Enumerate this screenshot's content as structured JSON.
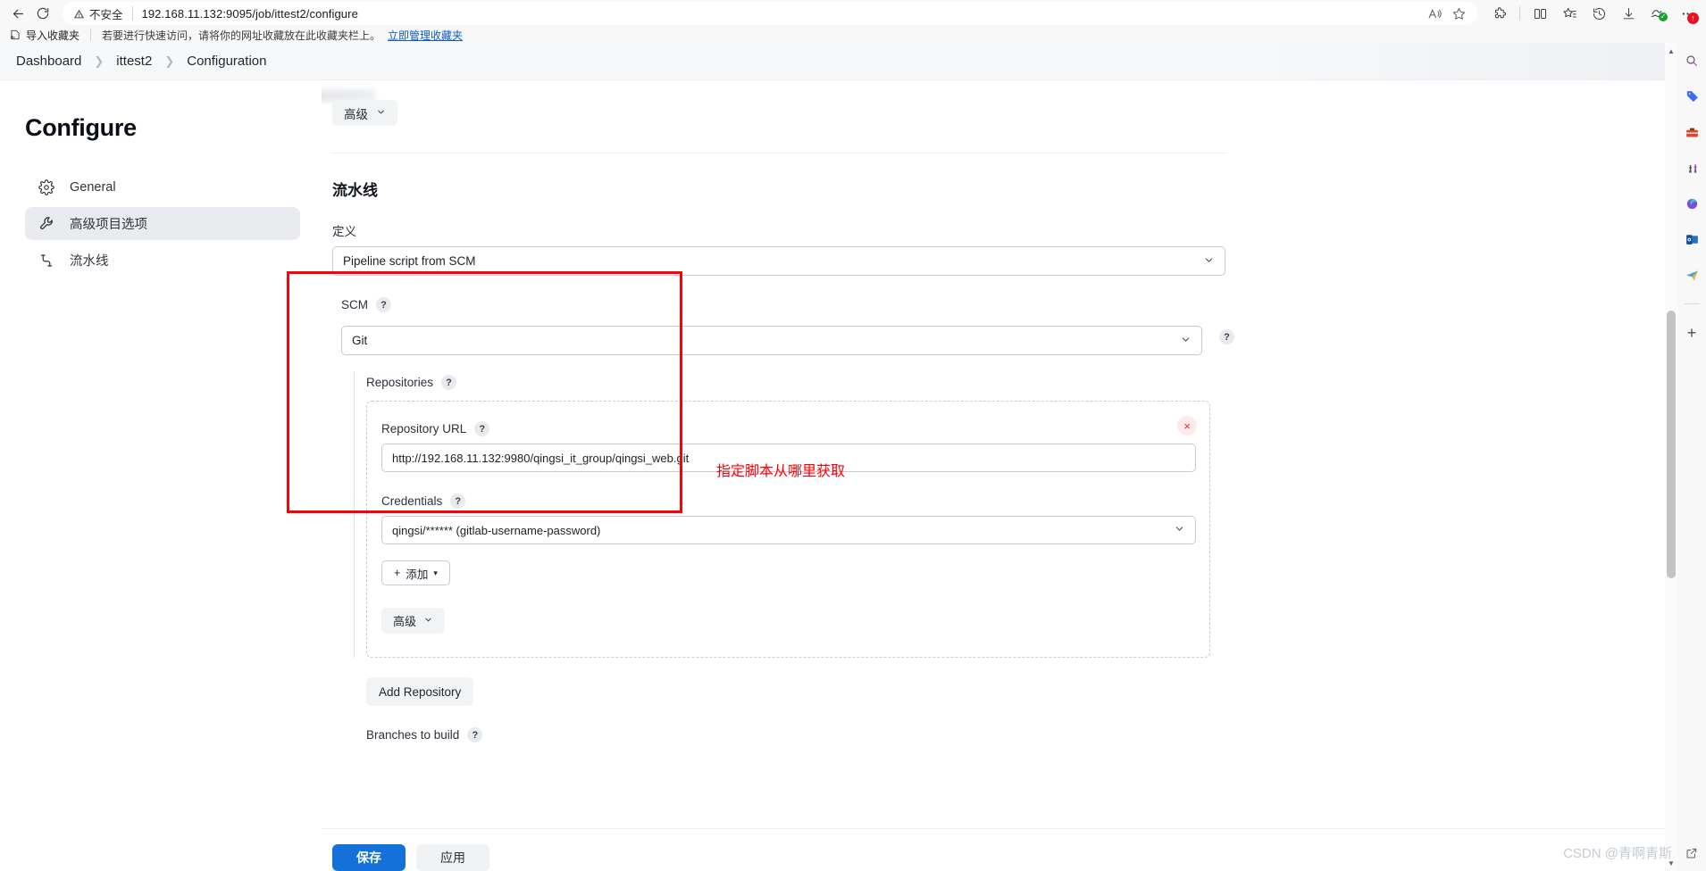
{
  "browser": {
    "back_tooltip": "Back",
    "refresh_tooltip": "Refresh",
    "security_label": "不安全",
    "url": "192.168.11.132:9095/job/ittest2/configure",
    "read_aloud_icon": "read-aloud-icon",
    "favorite_icon": "star-icon",
    "toolbar_icons": [
      "extensions-icon",
      "split-screen-icon",
      "collections-icon",
      "history-icon",
      "downloads-icon",
      "browser-essentials-icon",
      "settings-more-icon"
    ],
    "more_badge": "↑",
    "bookmarks": {
      "import_label": "导入收藏夹",
      "hint": "若要进行快速访问，请将你的网址收藏放在此收藏夹栏上。",
      "manage_link": "立即管理收藏夹"
    },
    "sidebar_icons": [
      "search-icon",
      "shopping-tag-icon",
      "tools-icon",
      "games-icon",
      "copilot-icon",
      "outlook-icon",
      "send-icon",
      "add-icon"
    ]
  },
  "breadcrumb": {
    "items": [
      {
        "label": "Dashboard"
      },
      {
        "label": "ittest2"
      },
      {
        "label": "Configuration"
      }
    ],
    "separator": "❯"
  },
  "sidebar": {
    "title": "Configure",
    "items": [
      {
        "label": "General",
        "icon": "gear-icon",
        "active": false
      },
      {
        "label": "高级项目选项",
        "icon": "wrench-icon",
        "active": true
      },
      {
        "label": "流水线",
        "icon": "pipeline-icon",
        "active": false
      }
    ]
  },
  "main": {
    "advanced_top": {
      "label": "高级",
      "icon": "chevron-down-icon"
    },
    "section_title": "流水线",
    "definition": {
      "label": "定义",
      "value": "Pipeline script from SCM",
      "icon": "chevron-down-icon"
    },
    "scm": {
      "label": "SCM",
      "help": "?",
      "value": "Git",
      "icon": "chevron-down-icon",
      "outer_help": "?"
    },
    "repositories": {
      "label": "Repositories",
      "help": "?",
      "remove_icon": "×",
      "repository_url": {
        "label": "Repository URL",
        "help": "?",
        "value": "http://192.168.11.132:9980/qingsi_it_group/qingsi_web.git"
      },
      "credentials": {
        "label": "Credentials",
        "help": "?",
        "value": "qingsi/****** (gitlab-username-password)",
        "icon": "chevron-down-icon"
      },
      "add_button": {
        "label": "添加",
        "prefix": "+",
        "caret": "▾"
      },
      "advanced_button": {
        "label": "高级",
        "icon": "chevron-down-icon"
      }
    },
    "add_repository_button": "Add Repository",
    "branches_to_build": {
      "label": "Branches to build",
      "help": "?"
    }
  },
  "annotation": {
    "note": "指定脚本从哪里获取",
    "color": "#fb0007"
  },
  "footer": {
    "save": "保存",
    "apply": "应用"
  },
  "watermark": "CSDN @青啊青斯"
}
